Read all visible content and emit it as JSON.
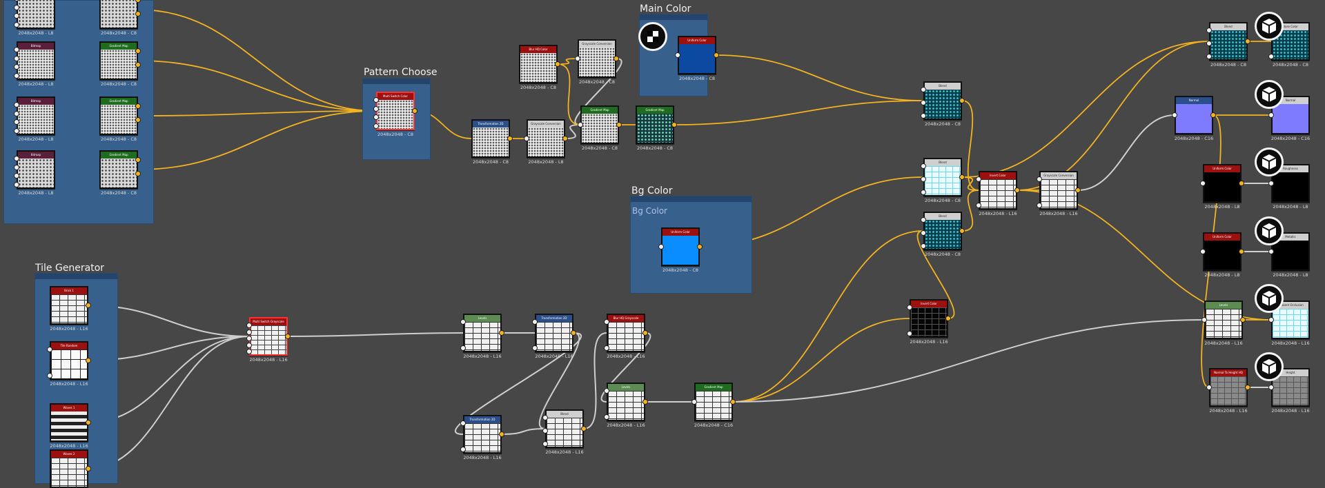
{
  "colors": {
    "canvas": "#474747",
    "frame": "#37608c",
    "wire_grey": "#cfcfcf",
    "wire_orange": "#f4b321",
    "header_red": "#9c1010",
    "header_green": "#1f6b1f",
    "header_grey": "#cfcfcf",
    "header_blue": "#2a4f8a",
    "header_maroon": "#5a1f3a",
    "header_leaf": "#5c8c52"
  },
  "frames": {
    "pattern_choose": {
      "title": "Pattern Choose"
    },
    "main_color": {
      "title": "Main Color"
    },
    "bg_color": {
      "title": "Bg Color",
      "subtitle": "Bg Color"
    },
    "tile_generator": {
      "title": "Tile Generator"
    }
  },
  "icons": {
    "preview_badge": "cube-icon",
    "main_color_badge": "checker-icon"
  },
  "nodes": [
    {
      "id": "n01",
      "name": "node-bitmap-a",
      "label": "",
      "res": "2048x2048 - L8",
      "thumb": "noise",
      "hc": "header_maroon"
    },
    {
      "id": "n02",
      "name": "node-gradient-map-a",
      "label": "",
      "res": "2048x2048 - C8",
      "thumb": "noise",
      "hc": "header_green"
    },
    {
      "id": "n03",
      "name": "node-bitmap-b",
      "label": "Bitmap",
      "res": "2048x2048 - L8",
      "thumb": "noise2",
      "hc": "header_maroon"
    },
    {
      "id": "n04",
      "name": "node-gradient-map-b",
      "label": "Gradient Map",
      "res": "2048x2048 - C8",
      "thumb": "noise2",
      "hc": "header_green"
    },
    {
      "id": "n05",
      "name": "node-bitmap-c",
      "label": "Bitmap",
      "res": "2048x2048 - L8",
      "thumb": "noise2",
      "hc": "header_maroon"
    },
    {
      "id": "n06",
      "name": "node-gradient-map-c",
      "label": "Gradient Map",
      "res": "2048x2048 - C8",
      "thumb": "noise2",
      "hc": "header_green"
    },
    {
      "id": "n07",
      "name": "node-bitmap-d",
      "label": "Bitmap",
      "res": "2048x2048 - L8",
      "thumb": "noise",
      "hc": "header_maroon"
    },
    {
      "id": "n08",
      "name": "node-gradient-map-d",
      "label": "Gradient Map",
      "res": "2048x2048 - C8",
      "thumb": "noise",
      "hc": "header_green"
    },
    {
      "id": "n09",
      "name": "node-multi-switch-color",
      "label": "Multi Switch Color",
      "res": "2048x2048 - C8",
      "thumb": "switch",
      "hc": "header_red"
    },
    {
      "id": "n10",
      "name": "node-blur-hq-color",
      "label": "Blur HQ Color",
      "res": "2048x2048 - C8",
      "thumb": "noise2",
      "hc": "header_red"
    },
    {
      "id": "n11",
      "name": "node-grayscale-conversion-a",
      "label": "Grayscale Conversion",
      "res": "2048x2048 - C8",
      "thumb": "noise2",
      "hc": "header_grey"
    },
    {
      "id": "n12",
      "name": "node-transformation-2d-a",
      "label": "Transformation 2D",
      "res": "2048x2048 - C8",
      "thumb": "noise2",
      "hc": "header_blue"
    },
    {
      "id": "n13",
      "name": "node-grayscale-conversion-b",
      "label": "Grayscale Conversion",
      "res": "2048x2048 - L8",
      "thumb": "noise2",
      "hc": "header_grey"
    },
    {
      "id": "n14",
      "name": "node-gradient-map-e",
      "label": "Gradient Map",
      "res": "2048x2048 - C8",
      "thumb": "noise2",
      "hc": "header_green"
    },
    {
      "id": "n15",
      "name": "node-gradient-map-f",
      "label": "Gradient Map",
      "res": "2048x2048 - C8",
      "thumb": "teal2",
      "hc": "header_green"
    },
    {
      "id": "n16",
      "name": "node-uniform-color-main",
      "label": "Uniform Color",
      "res": "2048x2048 - C8",
      "thumb": "blue",
      "hc": "header_red"
    },
    {
      "id": "n17",
      "name": "node-blend-a",
      "label": "Blend",
      "res": "2048x2048 - C8",
      "thumb": "teal",
      "hc": "header_grey"
    },
    {
      "id": "n18",
      "name": "node-uniform-color-bg",
      "label": "Uniform Color",
      "res": "2048x2048 - C8",
      "thumb": "brightblue",
      "hc": "header_red"
    },
    {
      "id": "n19",
      "name": "node-blend-b",
      "label": "Blend",
      "res": "2048x2048 - C8",
      "thumb": "cyan",
      "hc": "header_grey"
    },
    {
      "id": "n20",
      "name": "node-blend-c",
      "label": "Blend",
      "res": "2048x2048 - C8",
      "thumb": "teal",
      "hc": "header_grey"
    },
    {
      "id": "n21",
      "name": "node-invert-color-a",
      "label": "Invert Color",
      "res": "2048x2048 - L16",
      "thumb": "brick",
      "hc": "header_red"
    },
    {
      "id": "n22",
      "name": "node-grayscale-conversion-c",
      "label": "Grayscale Conversion",
      "res": "2048x2048 - L16",
      "thumb": "brick",
      "hc": "header_grey"
    },
    {
      "id": "n23",
      "name": "node-invert-color-b",
      "label": "Invert Color",
      "res": "2048x2048 - L16",
      "thumb": "blackbrick",
      "hc": "header_red"
    },
    {
      "id": "n24",
      "name": "node-blend-out",
      "label": "Blend",
      "res": "2048x2048 - C8",
      "thumb": "teal",
      "hc": "header_grey"
    },
    {
      "id": "n25",
      "name": "node-output-basecolor",
      "label": "Base Color",
      "res": "2048x2048 - C8",
      "thumb": "teal",
      "hc": "header_grey"
    },
    {
      "id": "n26",
      "name": "node-normal",
      "label": "Normal",
      "res": "2048x2048 - C16",
      "thumb": "purple",
      "hc": "header_blue"
    },
    {
      "id": "n27",
      "name": "node-output-normal",
      "label": "Normal",
      "res": "2048x2048 - C16",
      "thumb": "purple",
      "hc": "header_grey"
    },
    {
      "id": "n28",
      "name": "node-uniform-color-c",
      "label": "Uniform Color",
      "res": "2048x2048 - L8",
      "thumb": "black",
      "hc": "header_red"
    },
    {
      "id": "n29",
      "name": "node-output-roughness",
      "label": "Roughness",
      "res": "2048x2048 - L8",
      "thumb": "black",
      "hc": "header_grey"
    },
    {
      "id": "n30",
      "name": "node-uniform-color-d",
      "label": "Uniform Color",
      "res": "2048x2048 - L8",
      "thumb": "black",
      "hc": "header_red"
    },
    {
      "id": "n31",
      "name": "node-output-metallic",
      "label": "Metallic",
      "res": "2048x2048 - L8",
      "thumb": "black",
      "hc": "header_grey"
    },
    {
      "id": "n32",
      "name": "node-levels-a",
      "label": "Levels",
      "res": "2048x2048 - L16",
      "thumb": "brick",
      "hc": "header_leaf"
    },
    {
      "id": "n33",
      "name": "node-output-ambient-occlusion",
      "label": "Ambient Occlusion",
      "res": "2048x2048 - L16",
      "thumb": "cyan",
      "hc": "header_grey"
    },
    {
      "id": "n34",
      "name": "node-normal-to-height-hq",
      "label": "Normal To Height HQ",
      "res": "2048x2048 - L16",
      "thumb": "grey",
      "hc": "header_red"
    },
    {
      "id": "n35",
      "name": "node-output-height",
      "label": "Height",
      "res": "2048x2048 - L16",
      "thumb": "grey",
      "hc": "header_grey"
    },
    {
      "id": "n36",
      "name": "node-brick-1",
      "label": "Brick 1",
      "res": "2048x2048 - L16",
      "thumb": "brick",
      "hc": "header_red"
    },
    {
      "id": "n37",
      "name": "node-tile-random",
      "label": "Tile Random",
      "res": "2048x2048 - L16",
      "thumb": "tile",
      "hc": "header_red"
    },
    {
      "id": "n38",
      "name": "node-waves-1",
      "label": "Waves 1",
      "res": "2048x2048 - L16",
      "thumb": "wave",
      "hc": "header_red"
    },
    {
      "id": "n39",
      "name": "node-waves-2",
      "label": "Waves 2",
      "res": "",
      "thumb": "brick",
      "hc": "header_red"
    },
    {
      "id": "n40",
      "name": "node-multi-switch-grayscale",
      "label": "Multi Switch Grayscale",
      "res": "2048x2048 - L16",
      "thumb": "brick2",
      "hc": "header_red"
    },
    {
      "id": "n41",
      "name": "node-levels-b",
      "label": "Levels",
      "res": "2048x2048 - L16",
      "thumb": "brick",
      "hc": "header_leaf"
    },
    {
      "id": "n42",
      "name": "node-transformation-2d-b",
      "label": "Transformation 2D",
      "res": "2048x2048 - L16",
      "thumb": "brick",
      "hc": "header_blue"
    },
    {
      "id": "n43",
      "name": "node-blur-hq-grayscale",
      "label": "Blur HQ Grayscale",
      "res": "2048x2048 - L16",
      "thumb": "brick",
      "hc": "header_red"
    },
    {
      "id": "n44",
      "name": "node-transformation-2d-c",
      "label": "Transformation 2D",
      "res": "2048x2048 - L16",
      "thumb": "brick",
      "hc": "header_blue"
    },
    {
      "id": "n45",
      "name": "node-blend-d",
      "label": "Blend",
      "res": "2048x2048 - L16",
      "thumb": "brick",
      "hc": "header_grey"
    },
    {
      "id": "n46",
      "name": "node-levels-c",
      "label": "Levels",
      "res": "2048x2048 - L16",
      "thumb": "brick",
      "hc": "header_leaf"
    },
    {
      "id": "n47",
      "name": "node-gradient-map-g",
      "label": "Gradient Map",
      "res": "2048x2048 - C16",
      "thumb": "brick",
      "hc": "header_green"
    }
  ],
  "edges": [
    {
      "from": "n02",
      "to": "n09",
      "color": "wire_orange"
    },
    {
      "from": "n04",
      "to": "n09",
      "color": "wire_orange"
    },
    {
      "from": "n06",
      "to": "n09",
      "color": "wire_orange"
    },
    {
      "from": "n08",
      "to": "n09",
      "color": "wire_orange"
    },
    {
      "from": "n01",
      "to": "n02",
      "color": "wire_grey"
    },
    {
      "from": "n03",
      "to": "n04",
      "color": "wire_grey"
    },
    {
      "from": "n05",
      "to": "n06",
      "color": "wire_grey"
    },
    {
      "from": "n07",
      "to": "n08",
      "color": "wire_grey"
    },
    {
      "from": "n09",
      "to": "n12",
      "color": "wire_orange"
    },
    {
      "from": "n12",
      "to": "n13",
      "color": "wire_orange"
    },
    {
      "from": "n13",
      "to": "n14",
      "color": "wire_grey"
    },
    {
      "from": "n10",
      "to": "n11",
      "color": "wire_orange"
    },
    {
      "from": "n11",
      "to": "n14",
      "color": "wire_grey"
    },
    {
      "from": "n14",
      "to": "n15",
      "color": "wire_orange"
    },
    {
      "from": "n10",
      "to": "n14",
      "color": "wire_orange"
    },
    {
      "from": "n15",
      "to": "n17",
      "color": "wire_orange"
    },
    {
      "from": "n16",
      "to": "n17",
      "color": "wire_orange"
    },
    {
      "from": "n17",
      "to": "n21",
      "color": "wire_orange"
    },
    {
      "from": "n18",
      "to": "n19",
      "color": "wire_orange"
    },
    {
      "from": "n19",
      "to": "n21",
      "color": "wire_orange"
    },
    {
      "from": "n20",
      "to": "n21",
      "color": "wire_orange"
    },
    {
      "from": "n21",
      "to": "n22",
      "color": "wire_orange"
    },
    {
      "from": "n21",
      "to": "n24",
      "color": "wire_orange"
    },
    {
      "from": "n19",
      "to": "n24",
      "color": "wire_orange"
    },
    {
      "from": "n22",
      "to": "n26",
      "color": "wire_grey"
    },
    {
      "from": "n24",
      "to": "n25",
      "color": "wire_orange"
    },
    {
      "from": "n26",
      "to": "n27",
      "color": "wire_orange"
    },
    {
      "from": "n28",
      "to": "n29",
      "color": "wire_grey"
    },
    {
      "from": "n30",
      "to": "n31",
      "color": "wire_grey"
    },
    {
      "from": "n32",
      "to": "n33",
      "color": "wire_orange"
    },
    {
      "from": "n34",
      "to": "n35",
      "color": "wire_grey"
    },
    {
      "from": "n26",
      "to": "n34",
      "color": "wire_orange"
    },
    {
      "from": "n21",
      "to": "n33",
      "color": "wire_orange"
    },
    {
      "from": "n36",
      "to": "n40",
      "color": "wire_grey"
    },
    {
      "from": "n37",
      "to": "n40",
      "color": "wire_grey"
    },
    {
      "from": "n38",
      "to": "n40",
      "color": "wire_grey"
    },
    {
      "from": "n39",
      "to": "n40",
      "color": "wire_grey"
    },
    {
      "from": "n40",
      "to": "n41",
      "color": "wire_grey"
    },
    {
      "from": "n41",
      "to": "n42",
      "color": "wire_grey"
    },
    {
      "from": "n42",
      "to": "n44",
      "color": "wire_grey"
    },
    {
      "from": "n42",
      "to": "n45",
      "color": "wire_grey"
    },
    {
      "from": "n44",
      "to": "n45",
      "color": "wire_grey"
    },
    {
      "from": "n43",
      "to": "n46",
      "color": "wire_grey"
    },
    {
      "from": "n45",
      "to": "n43",
      "color": "wire_grey"
    },
    {
      "from": "n46",
      "to": "n47",
      "color": "wire_grey"
    },
    {
      "from": "n47",
      "to": "n23",
      "color": "wire_orange"
    },
    {
      "from": "n47",
      "to": "n20",
      "color": "wire_orange"
    },
    {
      "from": "n47",
      "to": "n32",
      "color": "wire_grey"
    },
    {
      "from": "n23",
      "to": "n20",
      "color": "wire_orange"
    }
  ]
}
